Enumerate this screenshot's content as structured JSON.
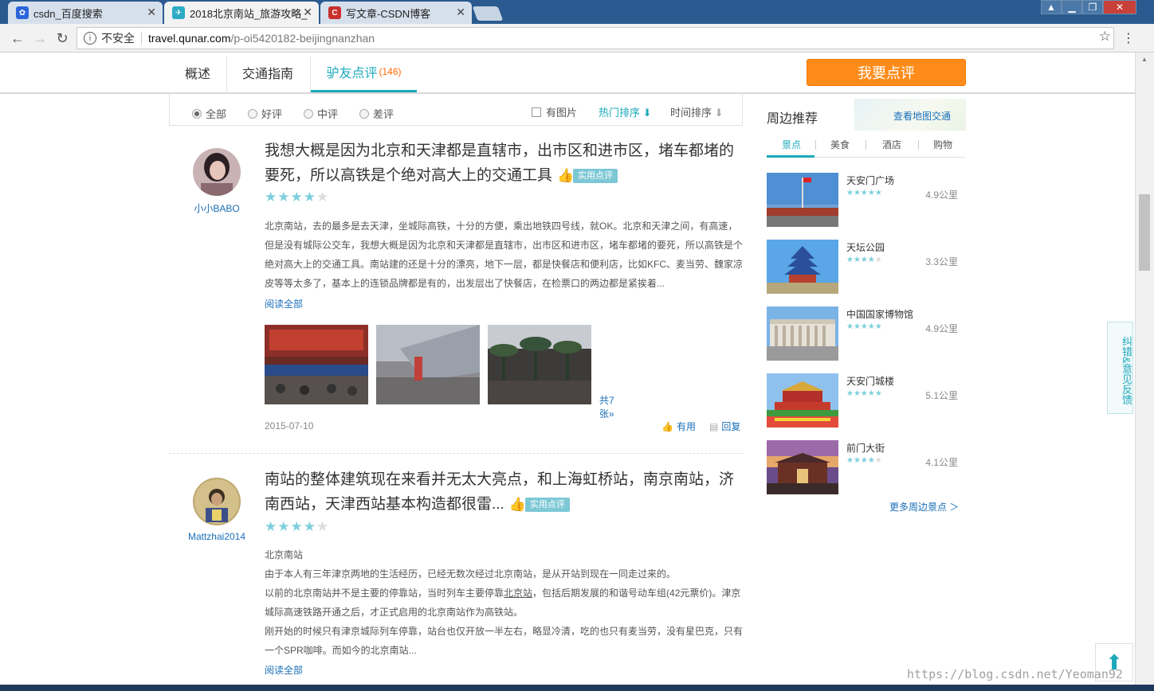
{
  "browser": {
    "tabs": [
      {
        "title": "csdn_百度搜索",
        "icon": "baidu-paw-icon",
        "color": "#2b65d9"
      },
      {
        "title": "2018北京南站_旅游攻略_",
        "icon": "qunar-icon",
        "color": "#2dabc5"
      },
      {
        "title": "写文章-CSDN博客",
        "icon": "csdn-icon",
        "color": "#c9302c"
      }
    ],
    "security_label": "不安全",
    "url_host": "travel.qunar.com",
    "url_path": "/p-oi5420182-beijingnanzhan"
  },
  "pagenav": {
    "tabs": [
      "概述",
      "交通指南",
      "驴友点评"
    ],
    "review_count": "(146)",
    "review_button": "我要点评"
  },
  "filters": {
    "radios": [
      "全部",
      "好评",
      "中评",
      "差评"
    ],
    "has_photo": "有图片",
    "sort_hot": "热门排序",
    "sort_time": "时间排序"
  },
  "reviews": [
    {
      "user": "小小BABO",
      "title": "我想大概是因为北京和天津都是直辖市，出市区和进市区，堵车都堵的要死，所以高铁是个绝对高大上的交通工具",
      "badge": "实用点评",
      "rating": 4,
      "body": "北京南站，去的最多是去天津，坐城际高铁，十分的方便，乘出地铁四号线，就OK。北京和天津之间，有高速，但是没有城际公交车，我想大概是因为北京和天津都是直辖市，出市区和进市区，堵车都堵的要死，所以高铁是个绝对高大上的交通工具。南站建的还是十分的漂亮，地下一层，都是快餐店和便利店，比如KFC、麦当劳、魏家凉皮等等太多了，基本上的连锁品牌都是有的，出发层出了快餐店，在检票口的两边都是紧挨着...",
      "read_all": "阅读全部",
      "photo_count": "共7张»",
      "date": "2015-07-10",
      "useful": "有用",
      "reply": "回复"
    },
    {
      "user": "Mattzhai2014",
      "title": "南站的整体建筑现在来看并无太大亮点，和上海虹桥站，南京南站，济南西站，天津西站基本构造都很雷...",
      "badge": "实用点评",
      "rating": 4,
      "body_lines": [
        "北京南站",
        "由于本人有三年津京两地的生活经历，已经无数次经过北京南站，是从开站到现在一同走过来的。",
        "以前的北京南站并不是主要的停靠站，当时列车主要停靠",
        "北京站",
        "，包括后期发展的和谐号动车组(42元票价)。津京城际高速铁路开通之后，才正式启用的北京南站作为高铁站。",
        "刚开始的时候只有津京城际列车停靠，站台也仅开放一半左右，略显冷清，吃的也只有麦当劳，没有星巴克，只有一个SPR咖啡。而如今的北京南站..."
      ],
      "read_all": "阅读全部"
    }
  ],
  "sidebar": {
    "title": "周边推荐",
    "map_link": "查看地图交通",
    "tabs": [
      "景点",
      "美食",
      "酒店",
      "购物"
    ],
    "pois": [
      {
        "name": "天安门广场",
        "rating": 5,
        "dist": "4.9公里"
      },
      {
        "name": "天坛公园",
        "rating": 4.5,
        "dist": "3.3公里"
      },
      {
        "name": "中国国家博物馆",
        "rating": 5,
        "dist": "4.9公里"
      },
      {
        "name": "天安门城楼",
        "rating": 5,
        "dist": "5.1公里"
      },
      {
        "name": "前门大街",
        "rating": 4,
        "dist": "4.1公里"
      }
    ],
    "more": "更多周边景点 ＞"
  },
  "feedback": "纠错&意见反馈",
  "watermark": "https://blog.csdn.net/Yeoman92",
  "colors": {
    "accent": "#1ba9ba",
    "orange": "#ff8c1a",
    "link": "#1a6fb8"
  }
}
